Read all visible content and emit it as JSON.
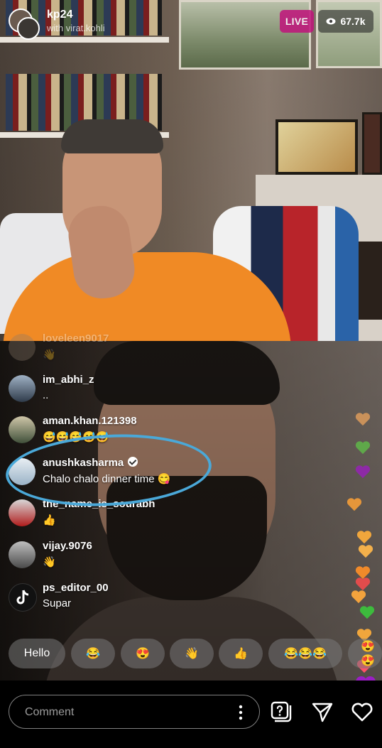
{
  "header": {
    "host_name": "kp24",
    "with_text": "with virat.kohli",
    "live_label": "LIVE",
    "viewer_count": "67.7k"
  },
  "comments": [
    {
      "user": "loveleen9017",
      "text": "👋",
      "faded": true
    },
    {
      "user": "im_abhi_z",
      "text": ".."
    },
    {
      "user": "aman.khan.121398",
      "text": "😅😅😅😅😅"
    },
    {
      "user": "anushkasharma",
      "text": "Chalo chalo dinner time 😋",
      "verified": true
    },
    {
      "user": "the_name_is_sourabh",
      "text": "👍"
    },
    {
      "user": "vijay.9076",
      "text": "👋"
    },
    {
      "user": "ps_editor_00",
      "text": "Supar"
    }
  ],
  "quick_replies": [
    "Hello",
    "😂",
    "😍",
    "👋",
    "👍",
    "😂😂😂",
    "😍😍"
  ],
  "composer": {
    "placeholder": "Comment"
  },
  "icons": {
    "more": "more-vertical-icon",
    "question": "question-box-icon",
    "send": "send-icon",
    "like": "heart-outline-icon"
  },
  "colors": {
    "live_badge": "#c0137b",
    "highlight_ring": "#4aa8d8"
  }
}
